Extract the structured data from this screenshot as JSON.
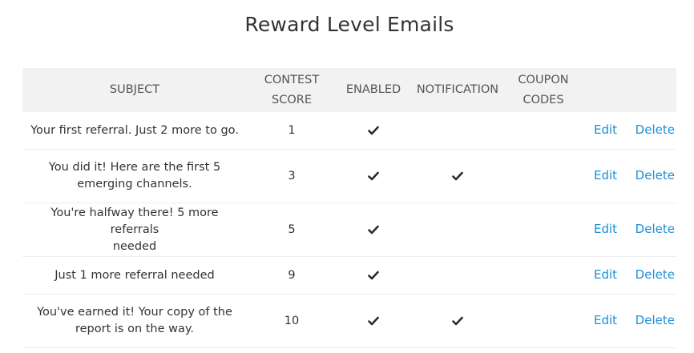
{
  "page": {
    "title": "Reward Level Emails"
  },
  "table": {
    "headers": {
      "subject": "SUBJECT",
      "contest_score_line1": "CONTEST",
      "contest_score_line2": "SCORE",
      "enabled": "ENABLED",
      "notification": "NOTIFICATION",
      "coupon_codes_line1": "COUPON",
      "coupon_codes_line2": "CODES"
    },
    "rows": [
      {
        "subject_line1": "Your first referral. Just 2 more to go.",
        "subject_line2": "",
        "contest_score": "1",
        "enabled": true,
        "notification": false,
        "edit_label": "Edit",
        "delete_label": "Delete"
      },
      {
        "subject_line1": "You did it! Here are the first 5",
        "subject_line2": "emerging channels.",
        "contest_score": "3",
        "enabled": true,
        "notification": true,
        "edit_label": "Edit",
        "delete_label": "Delete"
      },
      {
        "subject_line1": "You're halfway there! 5 more referrals",
        "subject_line2": "needed",
        "contest_score": "5",
        "enabled": true,
        "notification": false,
        "edit_label": "Edit",
        "delete_label": "Delete"
      },
      {
        "subject_line1": "Just 1 more referral needed",
        "subject_line2": "",
        "contest_score": "9",
        "enabled": true,
        "notification": false,
        "edit_label": "Edit",
        "delete_label": "Delete"
      },
      {
        "subject_line1": "You've earned it! Your copy of the",
        "subject_line2": "report is on the way.",
        "contest_score": "10",
        "enabled": true,
        "notification": true,
        "edit_label": "Edit",
        "delete_label": "Delete"
      }
    ]
  },
  "icons": {
    "check": "check-icon"
  },
  "colors": {
    "link": "#1a8fd6",
    "header_bg": "#f2f2f2",
    "text": "#333333"
  }
}
